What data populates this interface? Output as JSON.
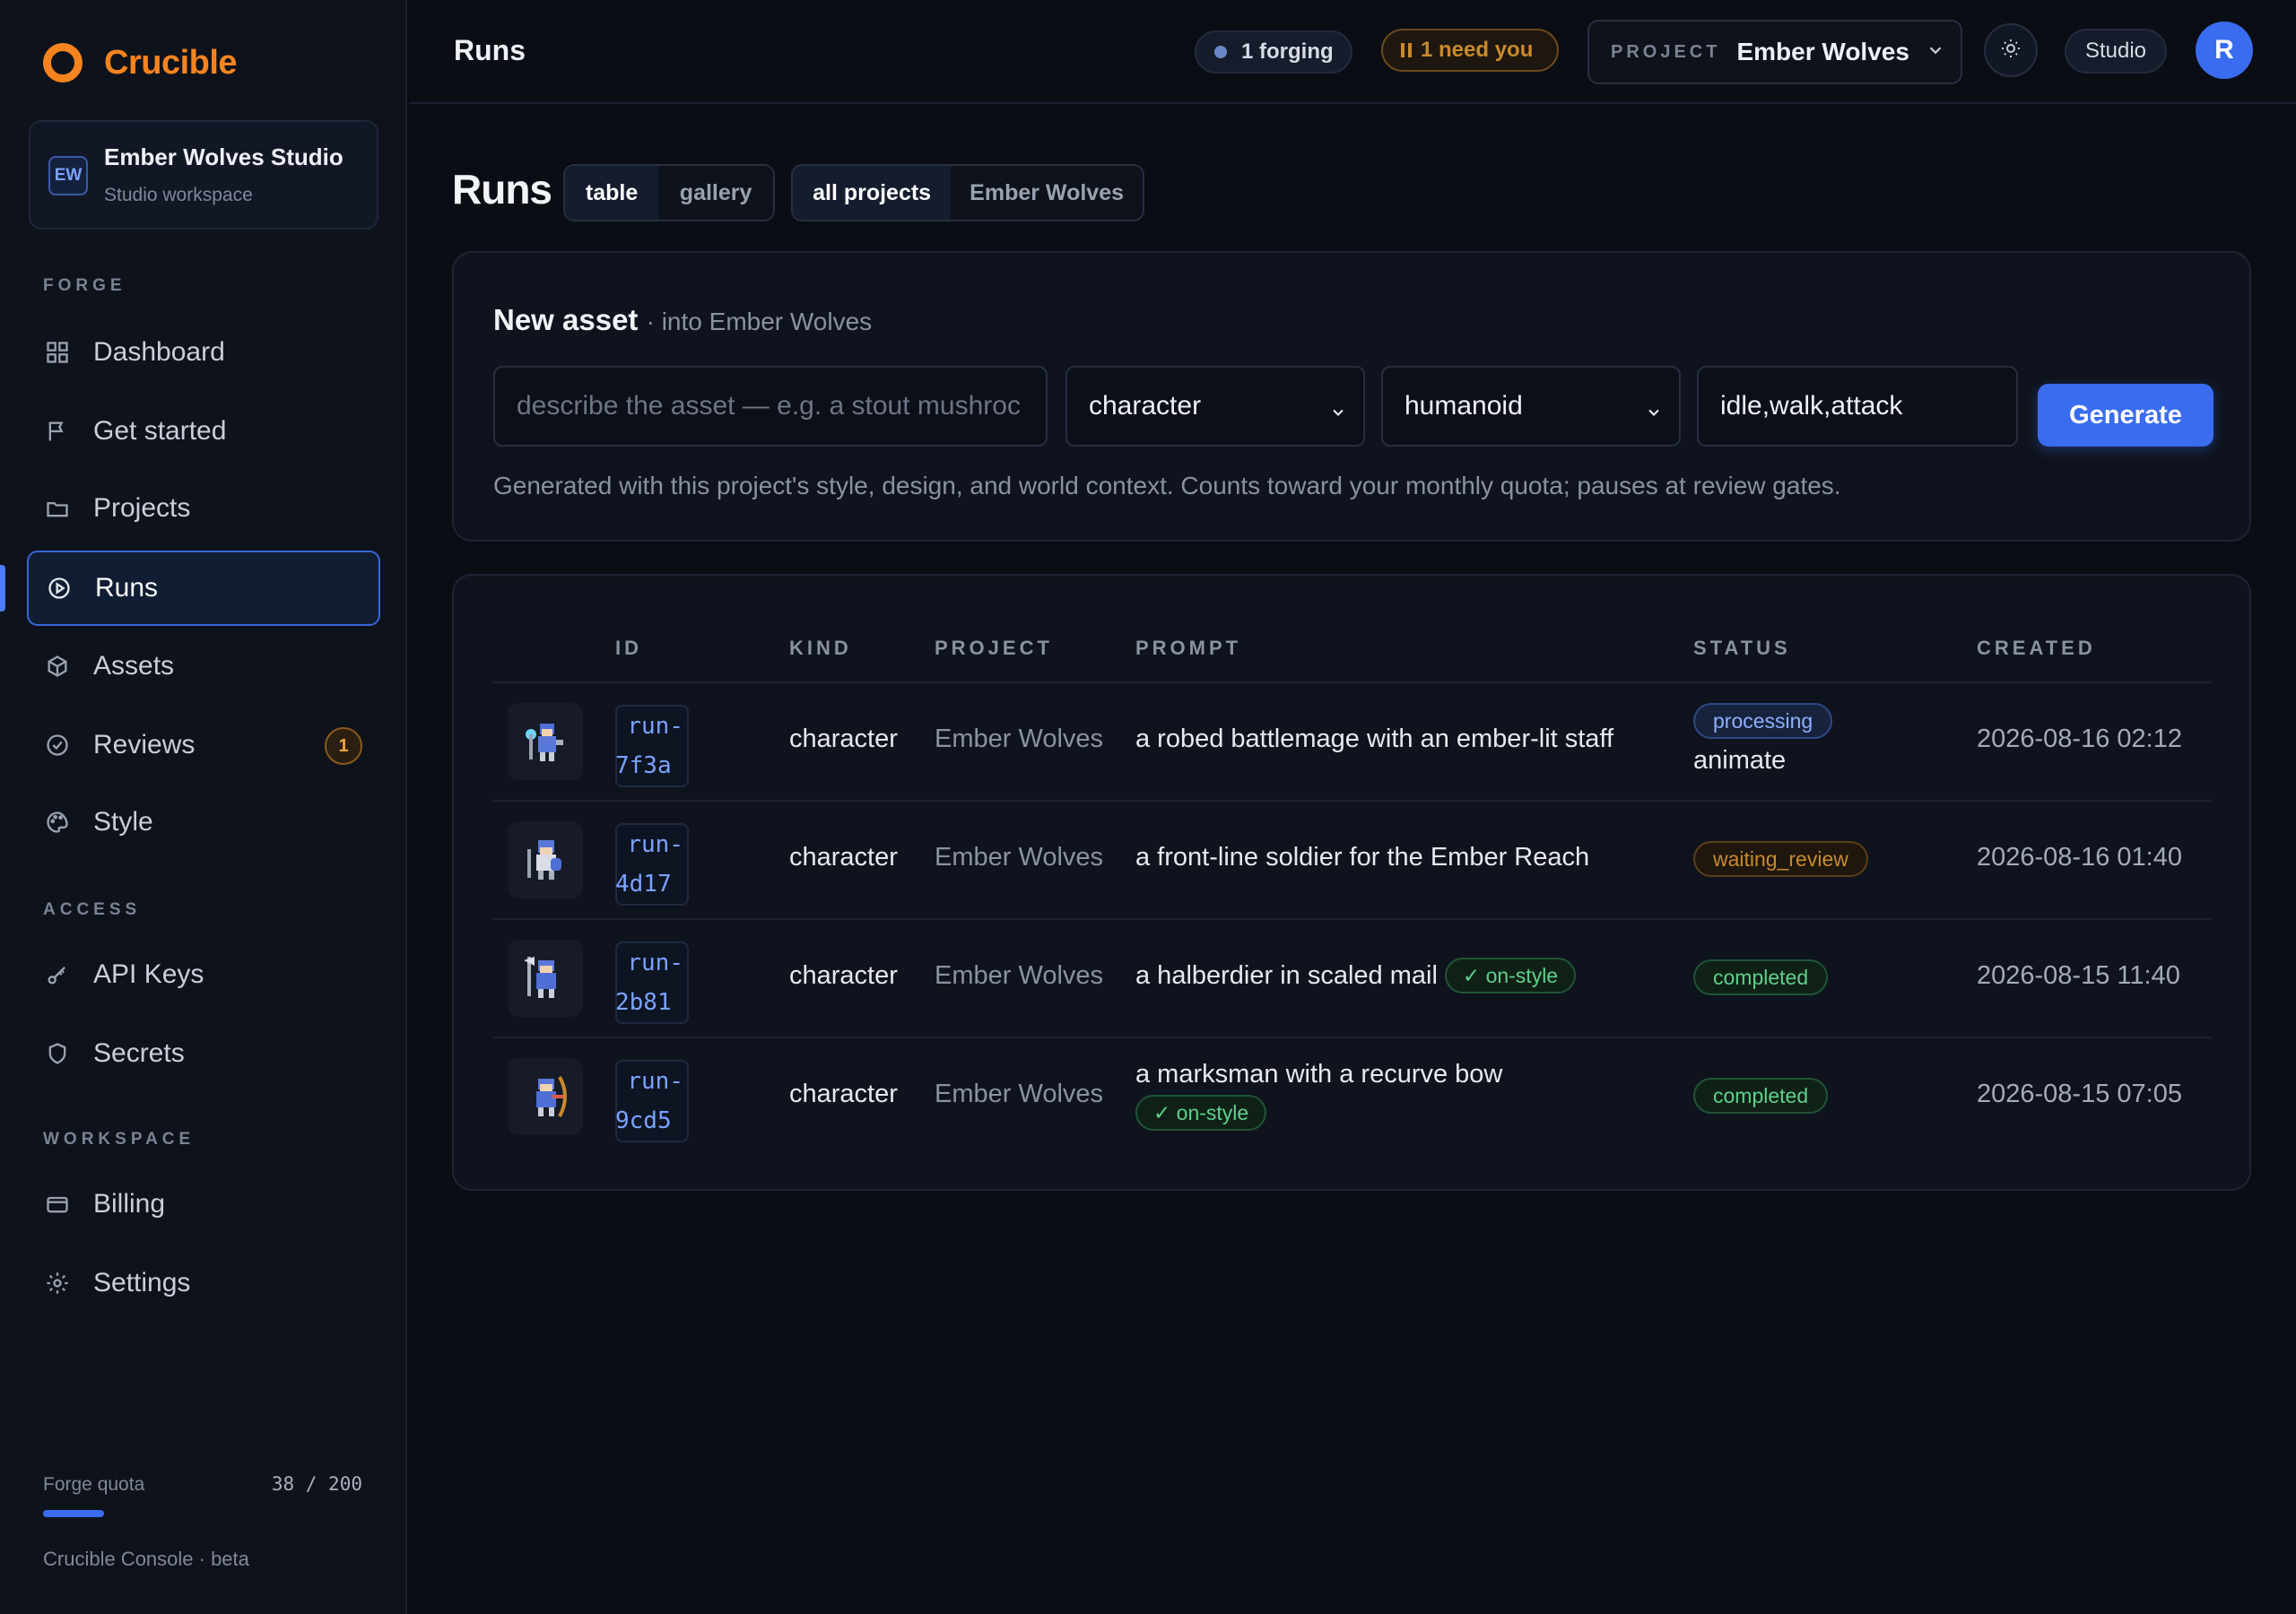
{
  "app": {
    "name": "Crucible",
    "brand_color": "#f5841f",
    "accent_color": "#3a6cf0"
  },
  "workspace": {
    "initials": "EW",
    "name": "Ember Wolves Studio",
    "subtitle": "Studio workspace"
  },
  "sidebar": {
    "sections": {
      "forge": "FORGE",
      "access": "ACCESS",
      "workspace": "WORKSPACE"
    },
    "items": [
      {
        "label": "Dashboard",
        "icon": "grid-icon"
      },
      {
        "label": "Get started",
        "icon": "flag-icon"
      },
      {
        "label": "Projects",
        "icon": "folder-icon"
      },
      {
        "label": "Runs",
        "icon": "play-circle-icon",
        "active": true
      },
      {
        "label": "Assets",
        "icon": "cube-icon"
      },
      {
        "label": "Reviews",
        "icon": "check-circle-icon",
        "badge": "1"
      },
      {
        "label": "Style",
        "icon": "palette-icon"
      },
      {
        "label": "API Keys",
        "icon": "key-icon"
      },
      {
        "label": "Secrets",
        "icon": "shield-icon"
      },
      {
        "label": "Billing",
        "icon": "card-icon"
      },
      {
        "label": "Settings",
        "icon": "gear-icon"
      }
    ],
    "quota": {
      "label": "Forge quota",
      "value": "38 / 200",
      "used": 38,
      "total": 200
    },
    "footer": "Crucible Console · beta"
  },
  "topbar": {
    "title": "Runs",
    "forging": "1 forging",
    "need_you": "1 need you",
    "project_label": "PROJECT",
    "project_name": "Ember Wolves",
    "studio": "Studio",
    "user_initial": "R"
  },
  "page": {
    "title": "Runs",
    "view_toggle": [
      "table",
      "gallery"
    ],
    "project_toggle": [
      "all projects",
      "Ember Wolves"
    ]
  },
  "new_asset": {
    "title": "New asset",
    "subtitle": "· into Ember Wolves",
    "description_placeholder": "describe the asset — e.g. a stout mushroc",
    "kind_value": "character",
    "rig_value": "humanoid",
    "animations_value": "idle,walk,attack",
    "generate_label": "Generate",
    "helper": "Generated with this project's style, design, and world context. Counts toward your monthly quota; pauses at review gates."
  },
  "table": {
    "headers": {
      "id": "ID",
      "kind": "KIND",
      "project": "PROJECT",
      "prompt": "PROMPT",
      "status": "STATUS",
      "created": "CREATED"
    },
    "rows": [
      {
        "id_prefix": "run-",
        "id_suffix": "7f3a",
        "kind": "character",
        "project": "Ember Wolves",
        "prompt": "a robed battlemage with an ember-lit staff",
        "on_style": "",
        "status": "processing",
        "status_detail": "animate",
        "created": "2026-08-16 02:12"
      },
      {
        "id_prefix": "run-",
        "id_suffix": "4d17",
        "kind": "character",
        "project": "Ember Wolves",
        "prompt": "a front-line soldier for the Ember Reach",
        "on_style": "",
        "status": "waiting_review",
        "status_detail": "",
        "created": "2026-08-16 01:40"
      },
      {
        "id_prefix": "run-",
        "id_suffix": "2b81",
        "kind": "character",
        "project": "Ember Wolves",
        "prompt": "a halberdier in scaled mail",
        "on_style": "✓ on-style",
        "status": "completed",
        "status_detail": "",
        "created": "2026-08-15 11:40"
      },
      {
        "id_prefix": "run-",
        "id_suffix": "9cd5",
        "kind": "character",
        "project": "Ember Wolves",
        "prompt": "a marksman with a recurve bow",
        "on_style": "✓ on-style",
        "status": "completed",
        "status_detail": "",
        "created": "2026-08-15 07:05"
      }
    ]
  }
}
